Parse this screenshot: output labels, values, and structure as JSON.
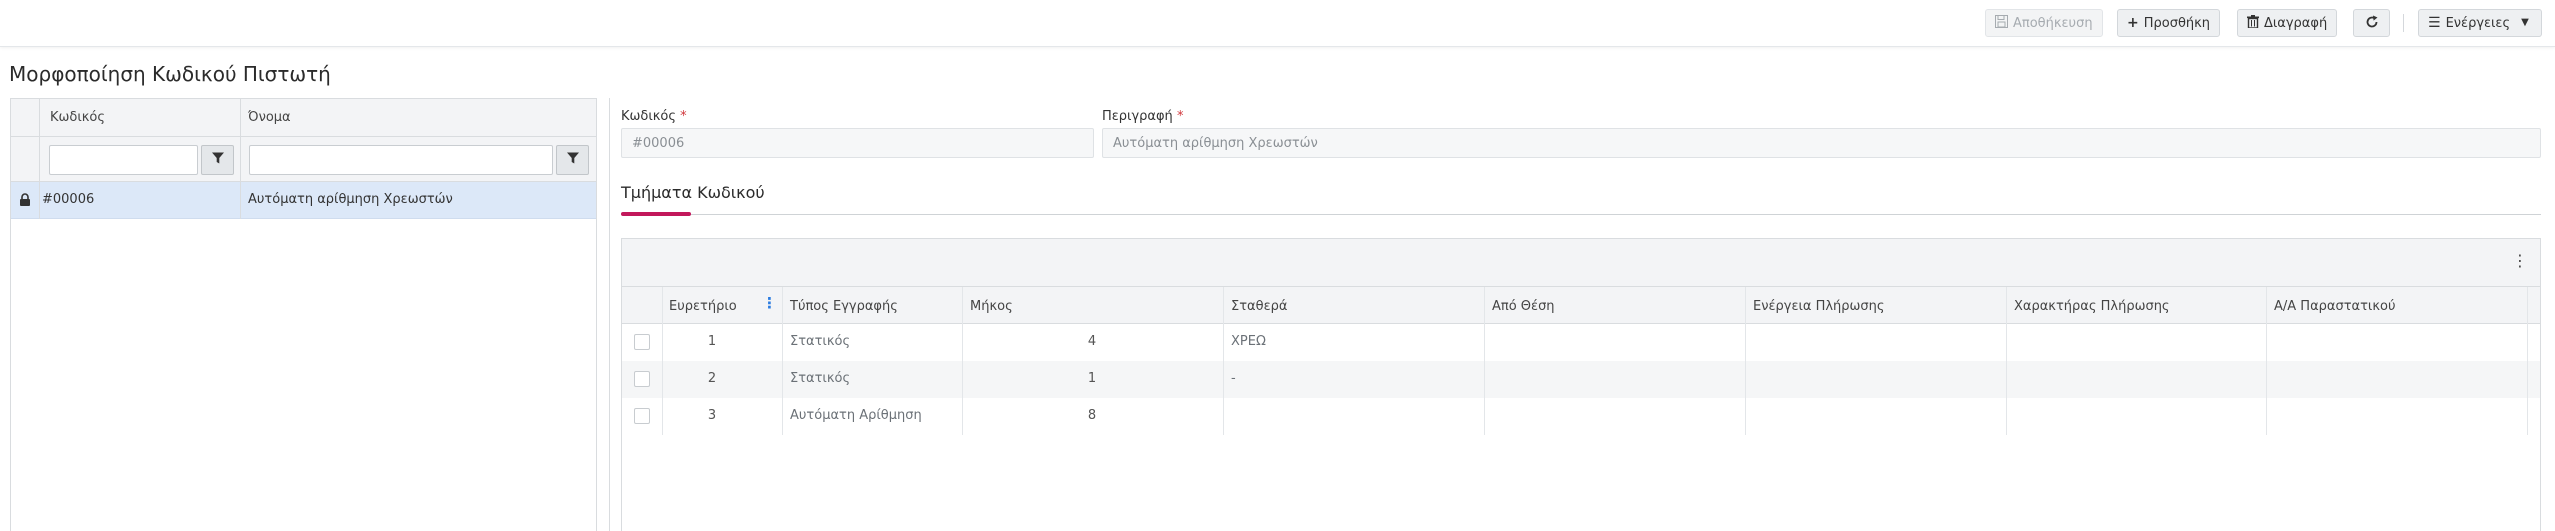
{
  "toolbar": {
    "save": "Αποθήκευση",
    "add": "Προσθήκη",
    "delete": "Διαγραφή",
    "actions": "Ενέργειες"
  },
  "page": {
    "title": "Μορφοποίηση Κωδικού Πιστωτή"
  },
  "list": {
    "columns": [
      "Κωδικός",
      "Όνομα"
    ],
    "rows": [
      {
        "code": "#00006",
        "name": "Αυτόματη αρίθμηση Χρεωστών",
        "locked": true
      }
    ]
  },
  "form": {
    "code_label": "Κωδικός",
    "code_value": "#00006",
    "description_label": "Περιγραφή",
    "description_value": "Αυτόματη αρίθμηση Χρεωστών",
    "required_mark": "*"
  },
  "tabs": {
    "active": "Τμήματα Κωδικού"
  },
  "segments": {
    "columns": [
      "Ευρετήριο",
      "Τύπος Εγγραφής",
      "Μήκος",
      "Σταθερά",
      "Από Θέση",
      "Ενέργεια Πλήρωσης",
      "Χαρακτήρας Πλήρωσης",
      "Α/Α Παραστατικού"
    ],
    "rows": [
      {
        "index": "1",
        "type": "Στατικός",
        "length": "4",
        "constant": "ΧΡΕΩ"
      },
      {
        "index": "2",
        "type": "Στατικός",
        "length": "1",
        "constant": "-"
      },
      {
        "index": "3",
        "type": "Αυτόματη Αρίθμηση",
        "length": "8",
        "constant": ""
      }
    ]
  },
  "colors": {
    "accent": "#c2185b",
    "selected_row": "#dce8f8",
    "required": "#d0353a",
    "column_menu": "#2a7be0"
  }
}
